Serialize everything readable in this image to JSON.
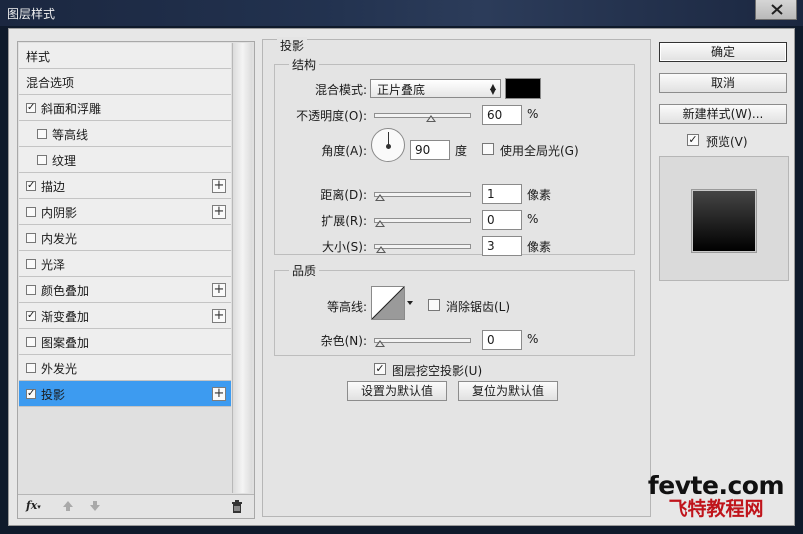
{
  "window": {
    "title": "图层样式"
  },
  "style_list": {
    "items": [
      {
        "label": "样式",
        "indent": 0,
        "checkbox": false,
        "checked": false,
        "plus": false,
        "selected": false
      },
      {
        "label": "混合选项",
        "indent": 0,
        "checkbox": false,
        "checked": false,
        "plus": false,
        "selected": false
      },
      {
        "label": "斜面和浮雕",
        "indent": 0,
        "checkbox": true,
        "checked": true,
        "plus": false,
        "selected": false
      },
      {
        "label": "等高线",
        "indent": 1,
        "checkbox": true,
        "checked": false,
        "plus": false,
        "selected": false
      },
      {
        "label": "纹理",
        "indent": 1,
        "checkbox": true,
        "checked": false,
        "plus": false,
        "selected": false
      },
      {
        "label": "描边",
        "indent": 0,
        "checkbox": true,
        "checked": true,
        "plus": true,
        "selected": false
      },
      {
        "label": "内阴影",
        "indent": 0,
        "checkbox": true,
        "checked": false,
        "plus": true,
        "selected": false
      },
      {
        "label": "内发光",
        "indent": 0,
        "checkbox": true,
        "checked": false,
        "plus": false,
        "selected": false
      },
      {
        "label": "光泽",
        "indent": 0,
        "checkbox": true,
        "checked": false,
        "plus": false,
        "selected": false
      },
      {
        "label": "颜色叠加",
        "indent": 0,
        "checkbox": true,
        "checked": false,
        "plus": true,
        "selected": false
      },
      {
        "label": "渐变叠加",
        "indent": 0,
        "checkbox": true,
        "checked": true,
        "plus": true,
        "selected": false
      },
      {
        "label": "图案叠加",
        "indent": 0,
        "checkbox": true,
        "checked": false,
        "plus": false,
        "selected": false
      },
      {
        "label": "外发光",
        "indent": 0,
        "checkbox": true,
        "checked": false,
        "plus": false,
        "selected": false
      },
      {
        "label": "投影",
        "indent": 0,
        "checkbox": true,
        "checked": true,
        "plus": true,
        "selected": true
      }
    ],
    "footer": {
      "fx_label": "fx"
    }
  },
  "drop_shadow": {
    "panel_title": "投影",
    "structure": {
      "legend": "结构",
      "blend_mode_label": "混合模式:",
      "blend_mode_value": "正片叠底",
      "blend_color": "#000000",
      "opacity_label": "不透明度(O):",
      "opacity_value": "60",
      "opacity_unit": "%",
      "opacity_level": 0.6,
      "angle_label": "角度(A):",
      "angle_value": "90",
      "angle_unit": "度",
      "global_light_label": "使用全局光(G)",
      "global_light_checked": false,
      "distance_label": "距离(D):",
      "distance_value": "1",
      "distance_unit": "像素",
      "distance_level": 0.0,
      "spread_label": "扩展(R):",
      "spread_value": "0",
      "spread_unit": "%",
      "spread_level": 0.0,
      "size_label": "大小(S):",
      "size_value": "3",
      "size_unit": "像素",
      "size_level": 0.01
    },
    "quality": {
      "legend": "品质",
      "contour_label": "等高线:",
      "anti_alias_label": "消除锯齿(L)",
      "anti_alias_checked": false,
      "noise_label": "杂色(N):",
      "noise_value": "0",
      "noise_unit": "%",
      "noise_level": 0.0
    },
    "knockout_label": "图层挖空投影(U)",
    "knockout_checked": true,
    "make_default_label": "设置为默认值",
    "reset_default_label": "复位为默认值"
  },
  "actions": {
    "ok_label": "确定",
    "cancel_label": "取消",
    "new_style_label": "新建样式(W)...",
    "preview_label": "预览(V)",
    "preview_checked": true
  },
  "watermark": {
    "top": "fevte.com",
    "bottom": "飞特教程网"
  },
  "colors": {
    "selected_row": "#3d9bf0",
    "accent_watermark": "#c0141b"
  }
}
